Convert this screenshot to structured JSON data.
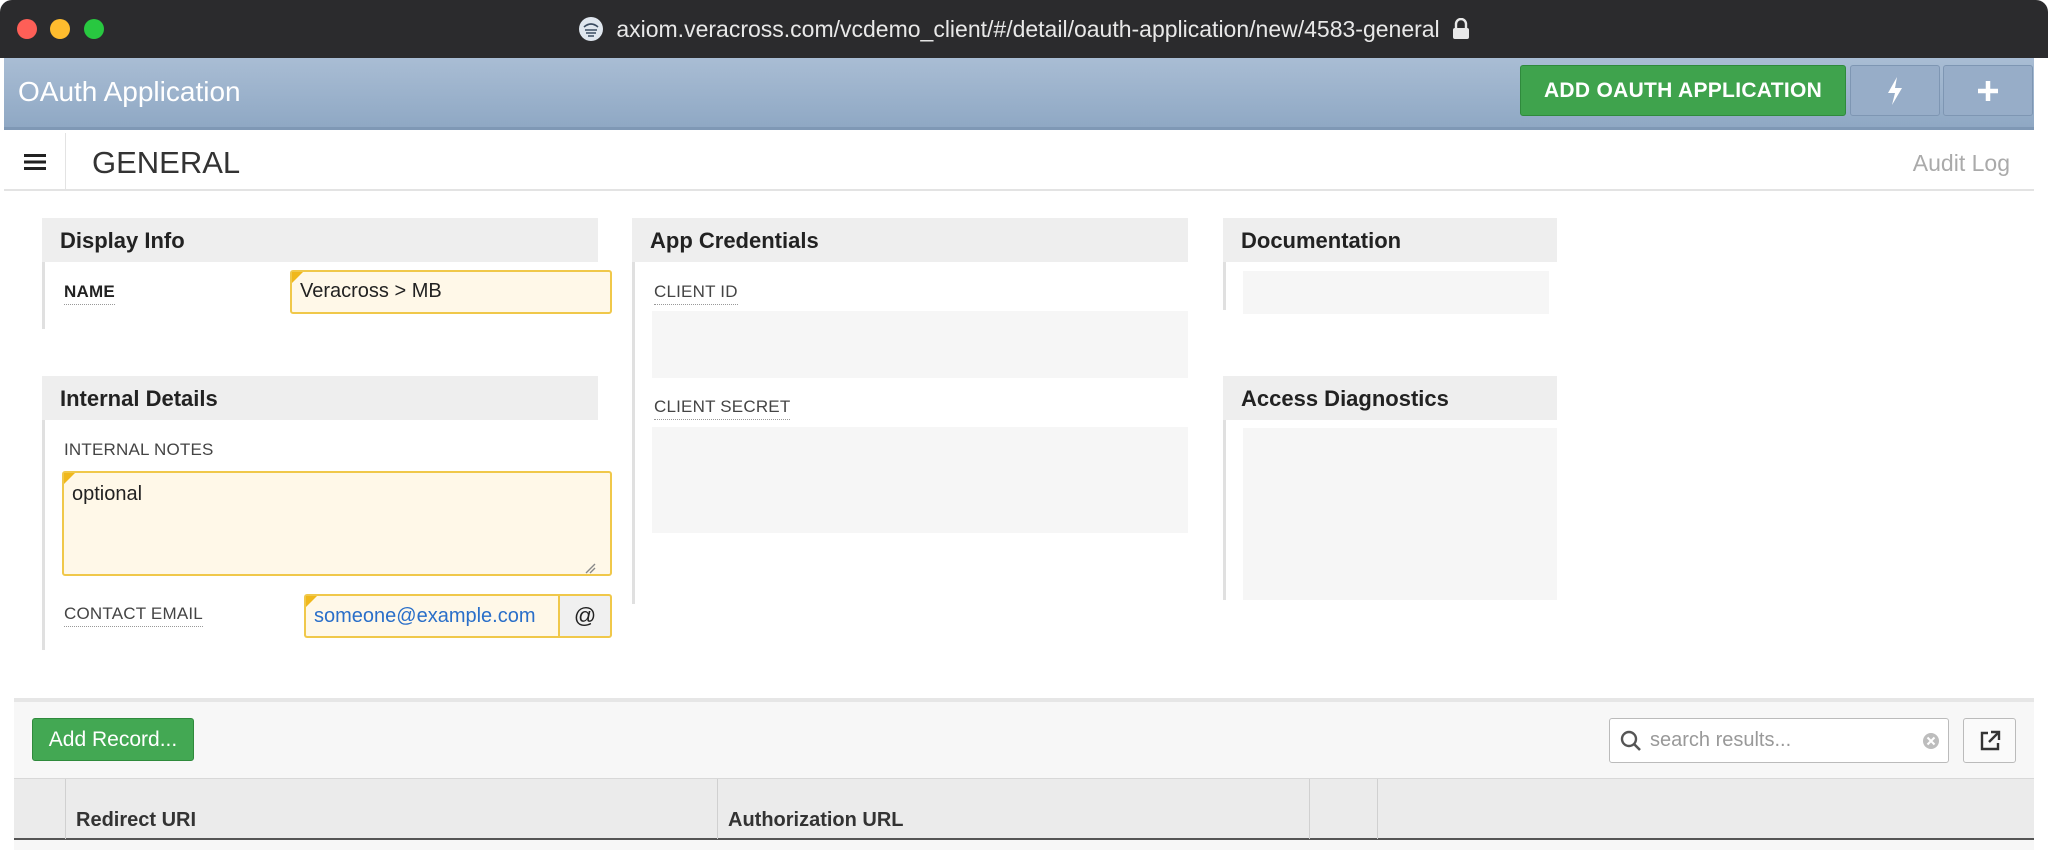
{
  "browser": {
    "url": "axiom.veracross.com/vcdemo_client/#/detail/oauth-application/new/4583-general"
  },
  "appbar": {
    "title": "OAuth Application",
    "add_button": "ADD OAUTH APPLICATION"
  },
  "subheader": {
    "title": "GENERAL",
    "audit_log": "Audit Log"
  },
  "display_info": {
    "heading": "Display Info",
    "name_label": "NAME",
    "name_value": "Veracross > MB"
  },
  "internal_details": {
    "heading": "Internal Details",
    "notes_label": "INTERNAL NOTES",
    "notes_value": "optional",
    "email_label": "CONTACT EMAIL",
    "email_value": "someone@example.com",
    "email_addon": "@"
  },
  "app_credentials": {
    "heading": "App Credentials",
    "client_id_label": "CLIENT ID",
    "client_secret_label": "CLIENT SECRET"
  },
  "documentation": {
    "heading": "Documentation"
  },
  "access_diagnostics": {
    "heading": "Access Diagnostics"
  },
  "grid": {
    "add_record": "Add Record...",
    "search_placeholder": "search results...",
    "columns": [
      "",
      "Redirect URI",
      "Authorization URL",
      "",
      ""
    ]
  },
  "colors": {
    "accent_green": "#3fa34d",
    "appbar_blue": "#9fb5cf",
    "required_yellow": "#f0c84a"
  }
}
